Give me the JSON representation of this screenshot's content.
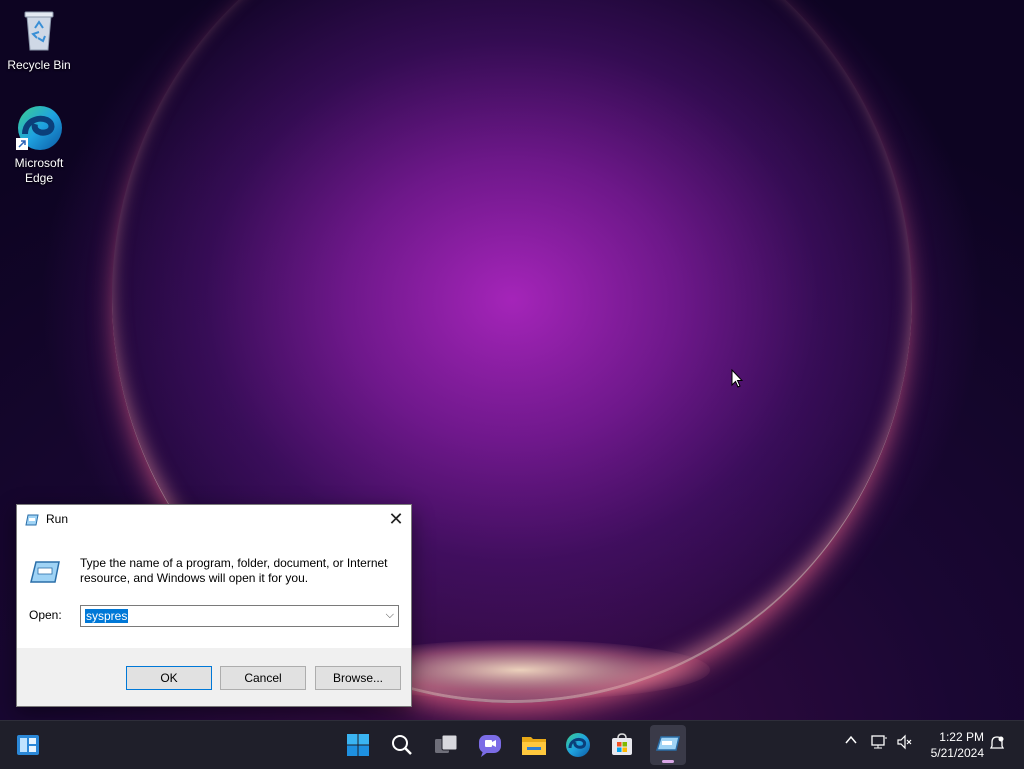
{
  "desktop": {
    "icons": [
      {
        "label": "Recycle Bin",
        "icon": "recycle-bin-icon"
      },
      {
        "label": "Microsoft Edge",
        "icon": "edge-icon"
      }
    ]
  },
  "run_dialog": {
    "title": "Run",
    "description": "Type the name of a program, folder, document, or Internet resource, and Windows will open it for you.",
    "open_label": "Open:",
    "open_value": "syspres",
    "ok_label": "OK",
    "cancel_label": "Cancel",
    "browse_label": "Browse...",
    "close_glyph": "✕"
  },
  "taskbar": {
    "items": [
      {
        "icon": "widgets-icon"
      },
      {
        "icon": "start-icon"
      },
      {
        "icon": "search-icon"
      },
      {
        "icon": "task-view-icon"
      },
      {
        "icon": "chat-icon"
      },
      {
        "icon": "file-explorer-icon"
      },
      {
        "icon": "edge-icon"
      },
      {
        "icon": "store-icon"
      },
      {
        "icon": "run-icon",
        "active": true
      }
    ],
    "tray": {
      "chevron_glyph": "^",
      "time": "1:22 PM",
      "date": "5/21/2024"
    }
  },
  "colors": {
    "accent": "#0078d7",
    "taskbar_bg": "#1f1f2a"
  }
}
